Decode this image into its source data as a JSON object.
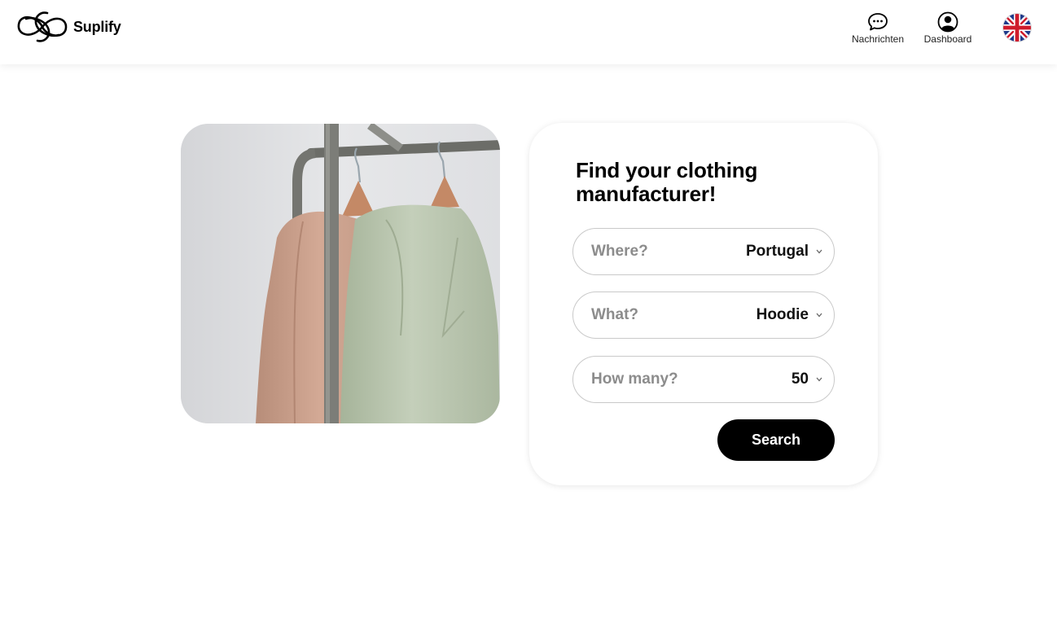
{
  "header": {
    "brand": "Suplify",
    "nav": [
      {
        "label": "Nachrichten",
        "icon": "chat-bubble-icon"
      },
      {
        "label": "Dashboard",
        "icon": "user-circle-icon"
      }
    ],
    "language_icon": "uk-flag-icon"
  },
  "hero": {
    "image": "clothing-rack-hoodies-photo"
  },
  "search_card": {
    "title": "Find your clothing manufacturer!",
    "fields": [
      {
        "label": "Where?",
        "value": "Portugal"
      },
      {
        "label": "What?",
        "value": "Hoodie"
      },
      {
        "label": "How many?",
        "value": "50"
      }
    ],
    "button_label": "Search"
  },
  "colors": {
    "primary": "#000000",
    "placeholder": "#8c8c8c",
    "border": "#c9c9c9"
  }
}
